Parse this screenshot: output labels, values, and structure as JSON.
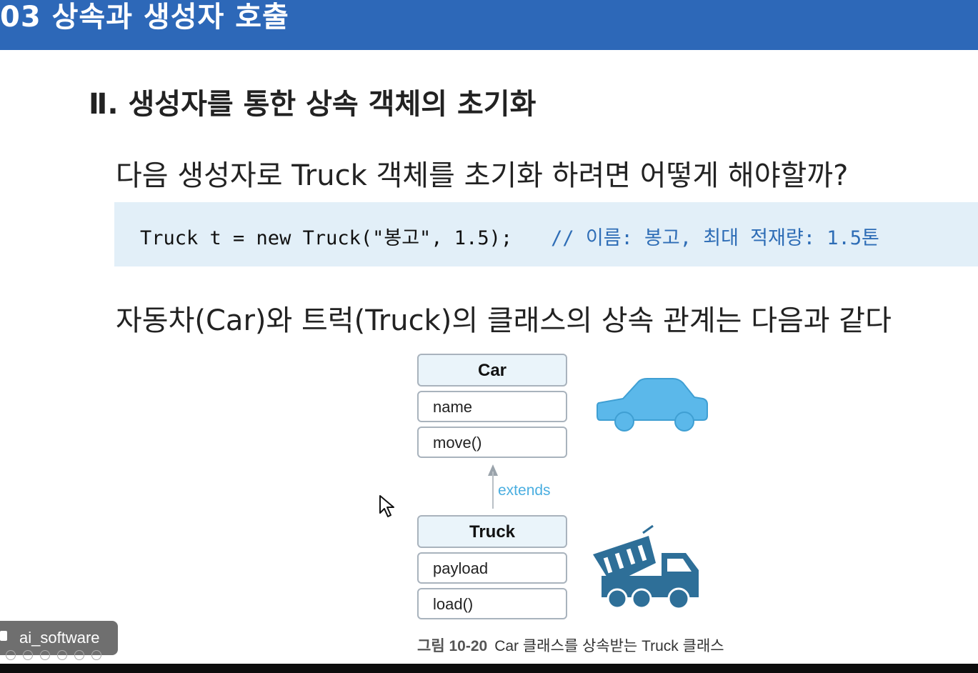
{
  "header": {
    "title": "03 상속과 생성자 호출"
  },
  "section": {
    "title": "Ⅱ. 생성자를 통한 상속 객체의 초기화"
  },
  "question": "다음 생성자로 Truck 객체를 초기화 하려면 어떻게 해야할까?",
  "code": {
    "statement": "Truck t = new Truck(\"봉고\", 1.5);",
    "comment": "// 이름: 봉고, 최대 적재량: 1.5톤"
  },
  "statement": "자동차(Car)와 트럭(Truck)의 클래스의 상속 관계는 다음과 같다",
  "diagram": {
    "parent": {
      "name": "Car",
      "field": "name",
      "method": "move()"
    },
    "relation": "extends",
    "child": {
      "name": "Truck",
      "field": "payload",
      "method": "load()"
    },
    "caption_number": "그림 10-20",
    "caption_text": "Car 클래스를 상속받는 Truck 클래스",
    "icons": [
      "car-icon",
      "dump-truck-icon"
    ],
    "colors": {
      "car": "#5bb8ea",
      "truck": "#2e6f98",
      "accent": "#4aaee0"
    }
  },
  "presenter": {
    "name": "ai_software"
  },
  "theme": {
    "header_bg": "#2d68b8",
    "code_bg": "#e2eff8",
    "comment": "#2e6db6"
  }
}
